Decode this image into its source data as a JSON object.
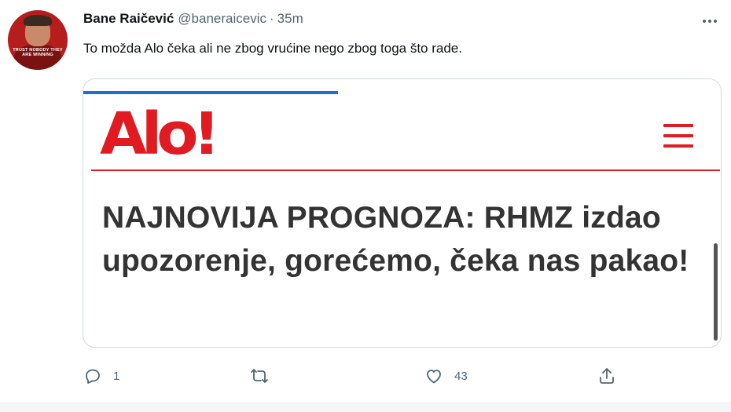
{
  "tweet": {
    "author_name": "Bane Raičević",
    "handle": "@baneraicevic",
    "separator": "·",
    "time": "35m",
    "avatar_caption": "TRUST NOBODY THEY ARE WINNING",
    "text": "To možda Alo čeka ali ne zbog vrućine nego zbog toga što rade."
  },
  "card": {
    "logo_text": "Alo!",
    "headline": "NAJNOVIJA PROGNOZA: RHMZ izdao upozorenje, gorećemo, čeka nas pakao!",
    "progress_fraction": 0.4
  },
  "actions": {
    "reply_count": "1",
    "retweet_count": "",
    "like_count": "43",
    "share_count": ""
  },
  "colors": {
    "brand_red": "#e11b22",
    "link_blue": "#1d6ed8",
    "muted": "#536471"
  }
}
